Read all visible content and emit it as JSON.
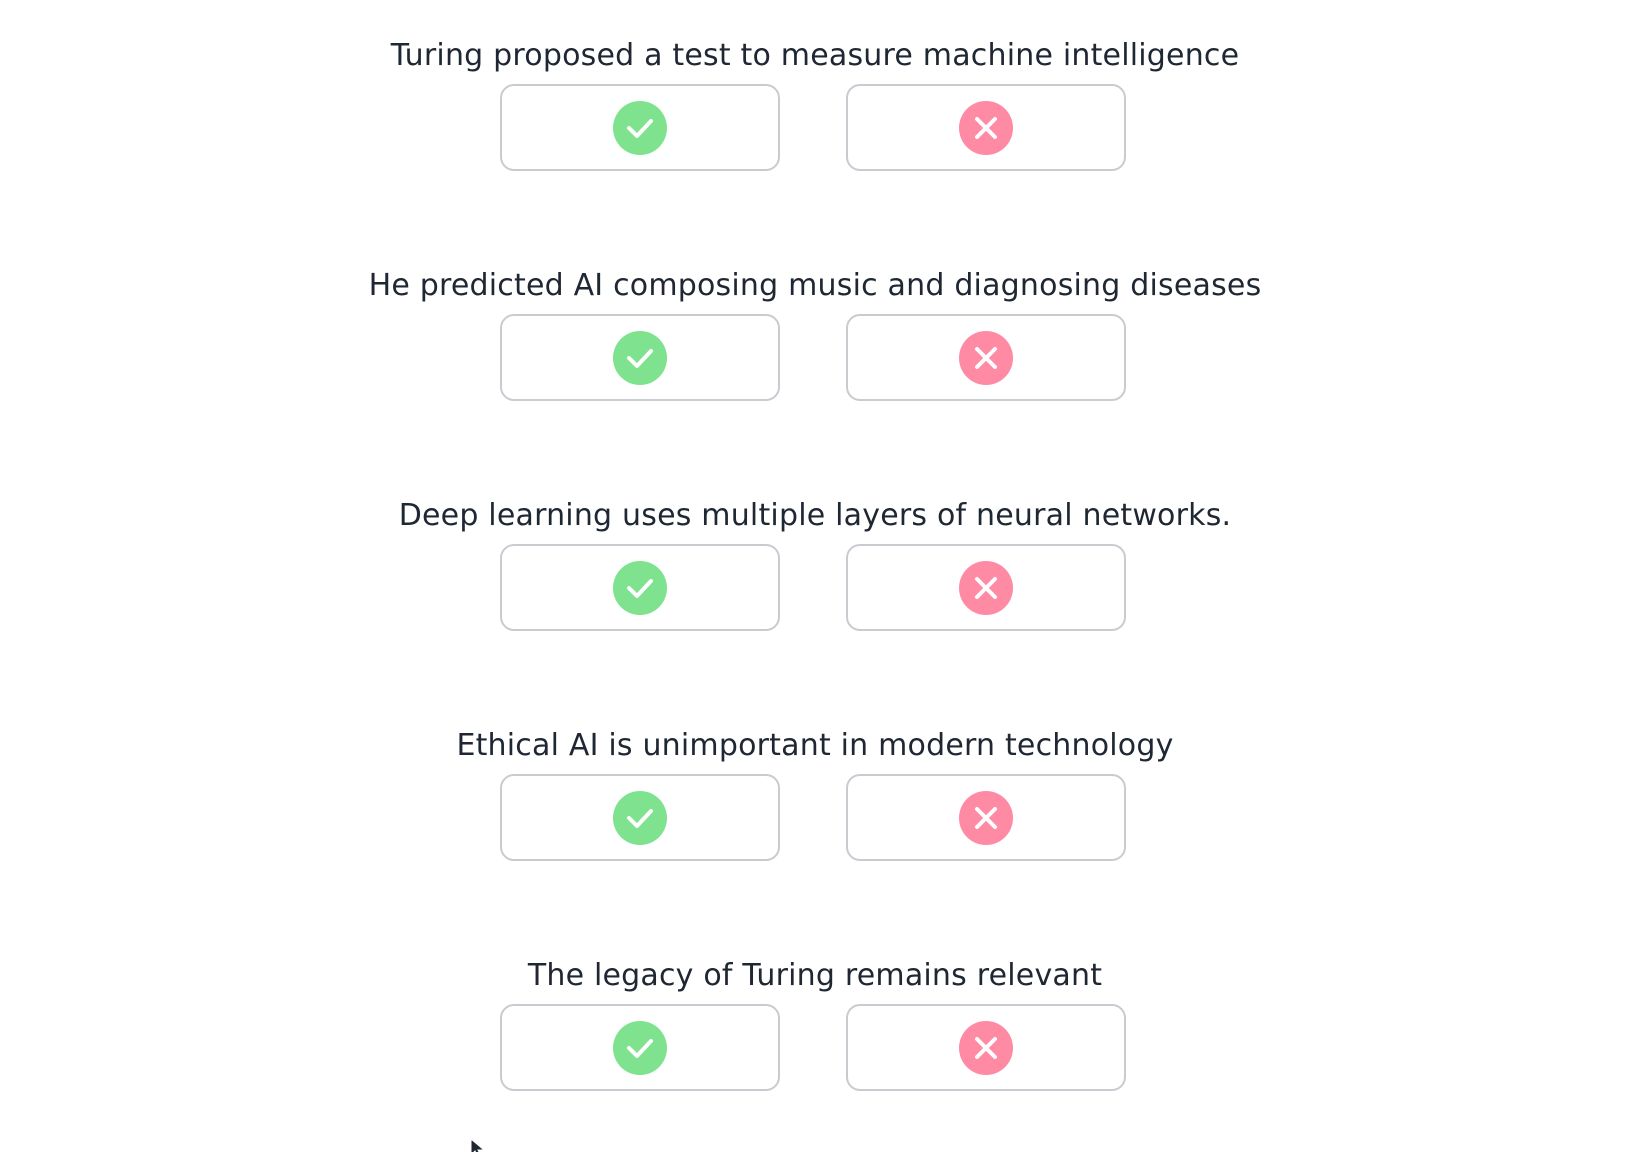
{
  "colors": {
    "true_accent": "#7ee28e",
    "false_accent": "#ff8aa3",
    "button_border": "#c8cbd0",
    "text": "#1f2733"
  },
  "icons": {
    "true": "check-circle-icon",
    "false": "x-circle-icon"
  },
  "questions": [
    {
      "statement": "Turing proposed a test to measure machine intelligence"
    },
    {
      "statement": "He predicted AI composing music and diagnosing diseases"
    },
    {
      "statement": "Deep learning uses multiple layers of neural networks."
    },
    {
      "statement": "Ethical AI is unimportant in modern technology"
    },
    {
      "statement": "The legacy of Turing remains relevant"
    }
  ]
}
